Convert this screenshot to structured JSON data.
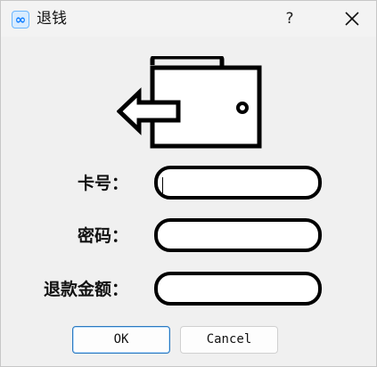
{
  "window": {
    "title": "退钱",
    "icon": "infinity-icon",
    "icon_glyph": "∞",
    "help_label": "?",
    "close_icon": "close-icon"
  },
  "illustration": {
    "icon": "wallet-withdraw-arrow-icon"
  },
  "form": {
    "card_label": "卡号：",
    "card_value": "",
    "password_label": "密码：",
    "password_value": "",
    "amount_label": "退款金额：",
    "amount_value": ""
  },
  "buttons": {
    "ok_label": "OK",
    "cancel_label": "Cancel"
  },
  "colors": {
    "background": "#f0f0f0",
    "field_border": "#000000",
    "ok_border": "#2a78bf",
    "app_icon_accent": "#0a7bff"
  }
}
